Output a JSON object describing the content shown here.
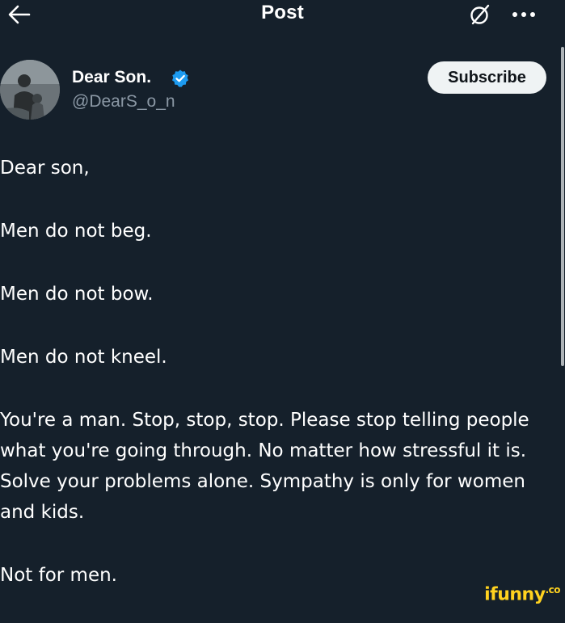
{
  "header": {
    "title": "Post",
    "back_icon": "arrow-left-icon",
    "grok_icon": "grok-icon",
    "more_icon": "more-horizontal-icon"
  },
  "author": {
    "display_name": "Dear Son.",
    "handle": "@DearS_o_n",
    "verified": true,
    "verified_color": "#1d9bf0",
    "subscribe_label": "Subscribe"
  },
  "post": {
    "lines": [
      "Dear son,",
      "Men do not beg.",
      "Men do not bow.",
      "Men do not kneel.",
      "You're a man. Stop, stop, stop. Please stop telling people what you're going through. No matter how stressful it is. Solve your problems alone. Sympathy is only for women and kids.",
      "Not for men."
    ]
  },
  "watermark": {
    "text": "ifunny",
    "suffix": ".co",
    "color": "#ffd21f"
  },
  "theme": {
    "background": "#15202b",
    "text": "#ffffff",
    "secondary_text": "#8b98a5"
  }
}
